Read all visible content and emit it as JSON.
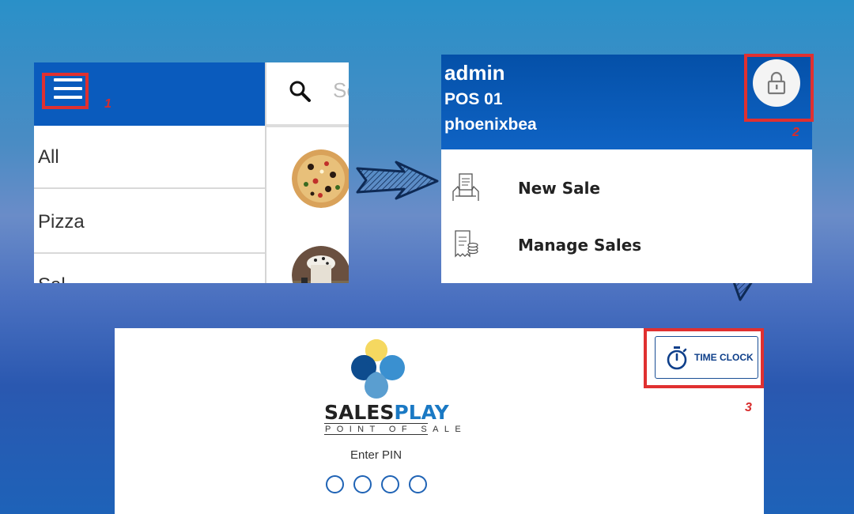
{
  "panel1": {
    "menu_marker": "1",
    "categories": [
      "All",
      "Pizza",
      "Sal"
    ],
    "search_placeholder": "Se"
  },
  "panel2": {
    "user": "admin",
    "terminal": "POS 01",
    "location": "phoenixbea",
    "lock_marker": "2",
    "menu_items": [
      {
        "label": "New Sale",
        "icon": "cash-register-icon"
      },
      {
        "label": "Manage Sales",
        "icon": "receipt-icon"
      }
    ]
  },
  "panel3": {
    "brand_sales": "SALES",
    "brand_play": "PLAY",
    "brand_tagline": "POINT OF SALE",
    "pin_label": "Enter PIN",
    "pin_dots": 4,
    "time_clock_label": "TIME CLOCK",
    "time_clock_marker": "3"
  },
  "colors": {
    "header_blue": "#0a5bbd",
    "highlight_red": "#e03030",
    "brand_blue": "#1a79c4",
    "pin_dot": "#1f63b5"
  }
}
